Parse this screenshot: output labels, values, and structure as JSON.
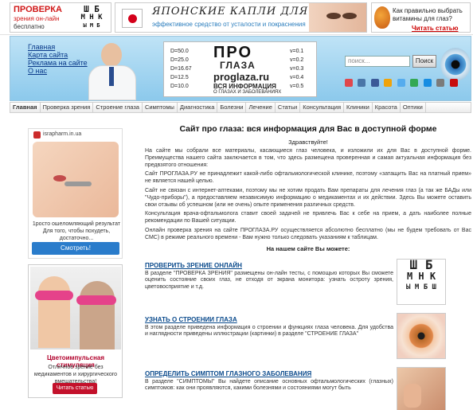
{
  "top_banners": {
    "promo1": {
      "title": "ПРОВЕРКА",
      "subtitle": "зрения он-лайн",
      "note": "бесплатно",
      "chart_lines": [
        "Ш Б",
        "М Н К",
        "Ы М Б"
      ]
    },
    "promo2": {
      "headline": "ЯПОНСКИЕ КАПЛИ ДЛЯ ГЛАЗ",
      "tagline": "эффективное средство от усталости и покраснения"
    },
    "promo3": {
      "question": "Как правильно выбрать витамины для глаз?",
      "link": "Читать статью"
    }
  },
  "header": {
    "links": [
      "Главная",
      "Карта сайта",
      "Реклама на сайте",
      "О нас"
    ],
    "board_left": [
      "D=50.0",
      "D=25.0",
      "D=16.67",
      "D=12.5",
      "D=10.0"
    ],
    "board_right": [
      "v=0.1",
      "v=0.2",
      "v=0.3",
      "v=0.4",
      "v=0.5"
    ],
    "board_big": "ПРО",
    "board_big2": "ГЛАЗА",
    "board_site": "proglaza.ru",
    "board_info": "ВСЯ ИНФОРМАЦИЯ",
    "board_info2": "О ГЛАЗАХ И ЗАБОЛЕВАНИЯХ",
    "search_placeholder": "поиск...",
    "search_button": "Поиск",
    "social_colors": [
      "#e0474c",
      "#4a76a8",
      "#3b5998",
      "#f0a30a",
      "#55acee",
      "#34a853",
      "#168de2",
      "#7b7b7b",
      "#c70d0d"
    ]
  },
  "nav": {
    "items": [
      "Главная",
      "Проверка зрения",
      "Строение глаза",
      "Симптомы",
      "Диагностика",
      "Болезни",
      "Лечение",
      "Статьи",
      "Консультация",
      "Клиники",
      "Красота",
      "Оптики"
    ]
  },
  "ads": {
    "ad1": {
      "source": "israpharm.in.ua",
      "text": "1росто ошеломляющий результат Для того, чтобы похудеть, достаточно...",
      "button": "Смотреть!"
    },
    "ad2": {
      "title": "Цветоимпульсная стимуляция",
      "text": "Отличное зрение без медикаментов и хирургического вмешательства!",
      "button": "Читать статью"
    }
  },
  "main": {
    "title": "Сайт про глаза: вся информация для Вас в доступной форме",
    "greeting": "Здравствуйте!",
    "paragraphs": [
      "На сайте мы собрали все материалы, касающиеся глаз человека, и изложили их для Вас в доступной форме. Преимущества нашего сайта заключается в том, что здесь размещена проверенная и самая актуальная информация без предвзятого отношения:",
      "Сайт ПРОГЛАЗА.РУ не принадлежит какой-либо офтальмологической клинике, поэтому «затащить Вас на платный прием» не является нашей целью.",
      "Сайт не связан с интернет-аптеками, поэтому мы не хотим продать Вам препараты для лечения глаз (а так же БАДы или \"Чудо-приборы\"), а предоставляем независимую информацию о медикаментах и их действии. Здесь Вы можете оставить свои отзывы об успешном (или не очень) опыте применения различных средств.",
      "Консультация врача-офтальмолога ставит своей задачей не привлечь Вас к себе на прием, а дать наиболее полные рекомендации по Вашей ситуации.",
      "Онлайн проверка зрения на сайте ПРОГЛАЗА.РУ осуществляется абсолютно бесплатно (мы не будем требовать от Вас СМС) в режиме реального времени - Вам нужно только следовать указаниям к таблицам."
    ],
    "cando": "На нашем сайте Вы можете:",
    "sections": [
      {
        "link": "ПРОВЕРИТЬ ЗРЕНИЕ ОНЛАЙН",
        "text": "В разделе \"ПРОВЕРКА ЗРЕНИЯ\" размещены он-лайн тесты, с помощью которых Вы сможете оценить состояние своих глаз, не отходя от экрана монитора: узнать остроту зрения, цветовосприятие и т.д.",
        "thumb_lines": [
          "Ш Б",
          "М Н К",
          "Ы М Б Ш"
        ]
      },
      {
        "link": "УЗНАТЬ О СТРОЕНИИ ГЛАЗА",
        "text": "В этом разделе приведена информация о строении и функциях глаза человека. Для удобства и наглядности приведены иллюстрации (картинки) в разделе \"СТРОЕНИЕ ГЛАЗА\""
      },
      {
        "link": "ОПРЕДЕЛИТЬ СИМПТОМ ГЛАЗНОГО ЗАБОЛЕВАНИЯ",
        "text": "В разделе \"СИМПТОМЫ\" Вы найдете описание основных офтальмологических (глазных) симптомов: как они проявляются, какими болезнями и состояниями могут быть"
      }
    ]
  }
}
